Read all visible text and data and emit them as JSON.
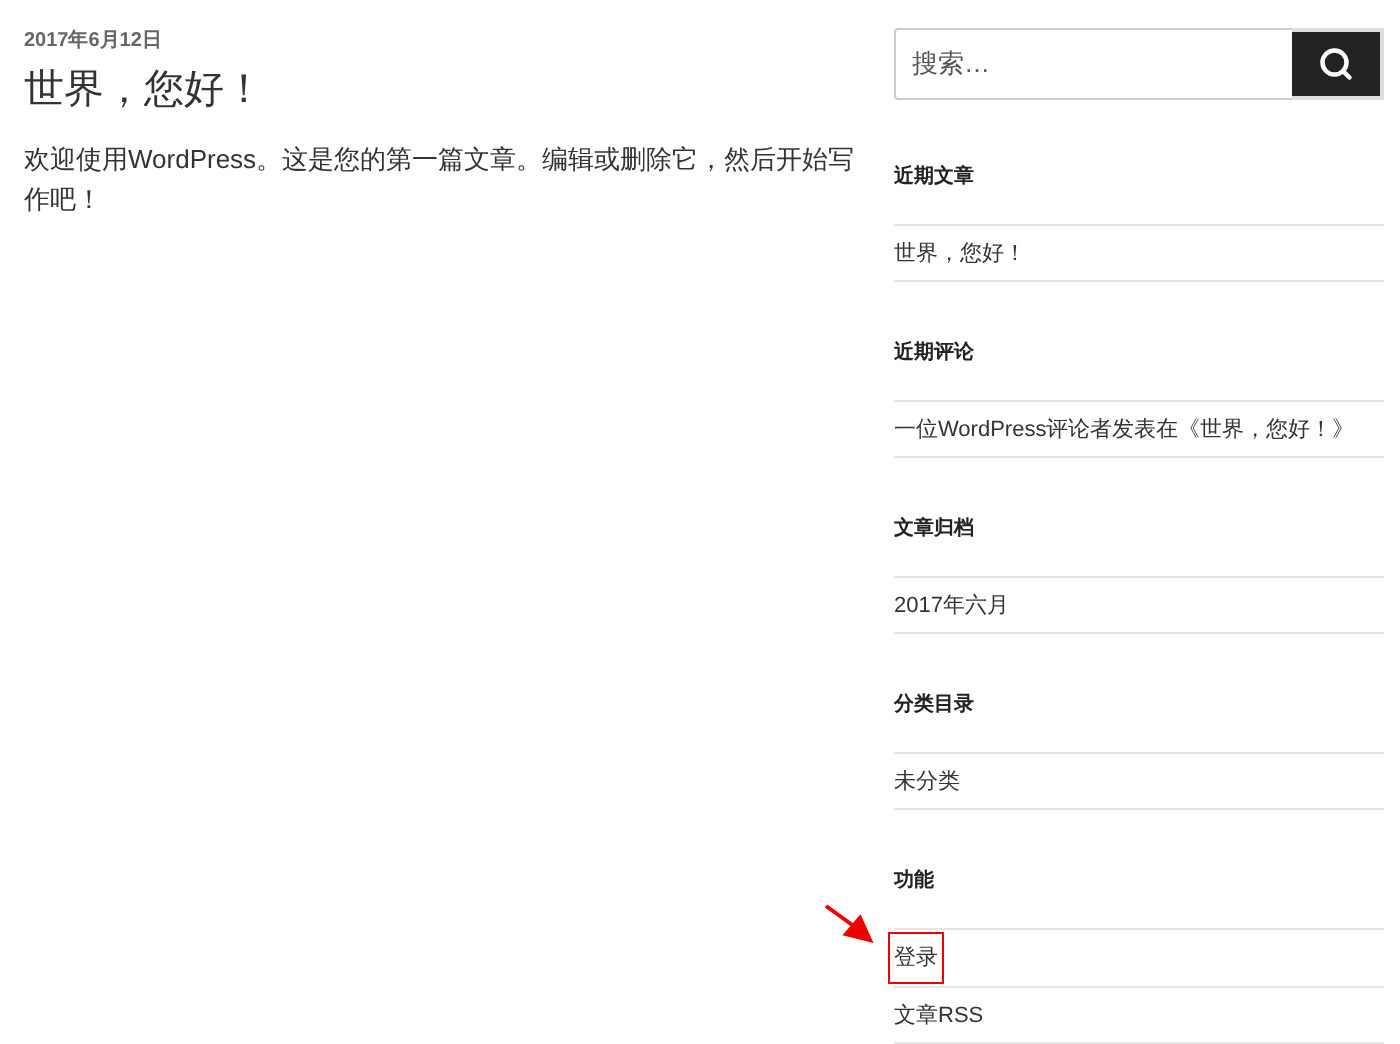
{
  "post": {
    "date": "2017年6月12日",
    "title": "世界，您好！",
    "body": "欢迎使用WordPress。这是您的第一篇文章。编辑或删除它，然后开始写作吧！"
  },
  "search": {
    "placeholder": "搜索…"
  },
  "widgets": [
    {
      "title": "近期文章",
      "items": [
        {
          "text": "世界，您好！",
          "highlighted": false
        }
      ]
    },
    {
      "title": "近期评论",
      "items": [
        {
          "text": "一位WordPress评论者发表在《世界，您好！》",
          "highlighted": false
        }
      ]
    },
    {
      "title": "文章归档",
      "items": [
        {
          "text": "2017年六月",
          "highlighted": false
        }
      ]
    },
    {
      "title": "分类目录",
      "items": [
        {
          "text": "未分类",
          "highlighted": false
        }
      ]
    },
    {
      "title": "功能",
      "items": [
        {
          "text": "登录",
          "highlighted": true
        },
        {
          "text": "文章RSS",
          "highlighted": false
        }
      ]
    }
  ]
}
